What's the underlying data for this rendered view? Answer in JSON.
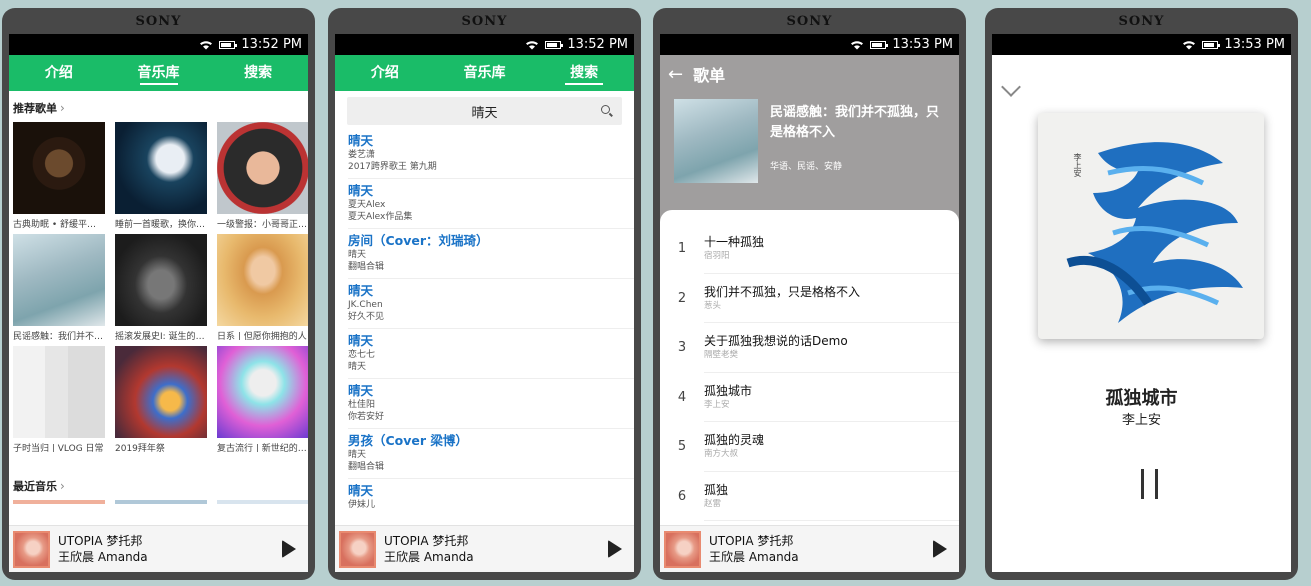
{
  "brand": "SONY",
  "status_times": [
    "13:52 PM",
    "13:52 PM",
    "13:53 PM",
    "13:53 PM"
  ],
  "tabs": [
    "介绍",
    "音乐库",
    "搜索"
  ],
  "library": {
    "recommend_title": "推荐歌单",
    "recent_title": "最近音乐",
    "playlists": [
      "古典助眠 • 舒缓平静的钢琴曲",
      "睡前一首暖歌，换你一夜好眠",
      "一级警报：小哥哥正在接近你",
      "民谣感触：我们并不孤独",
      "摇滚发展史I: 诞生的源头",
      "日系 | 但愿你拥抱的人",
      "子时当归 | VLOG 日常",
      "2019拜年祭",
      "复古流行 | 新世纪的浪潮"
    ]
  },
  "search": {
    "query": "晴天",
    "results": [
      {
        "title": "晴天",
        "a": "娄艺潇",
        "b": "2017跨界歌王 第九期"
      },
      {
        "title": "晴天",
        "a": "夏天Alex",
        "b": "夏天Alex作品集"
      },
      {
        "title": "房间（Cover：刘瑞琦）",
        "a": "晴天",
        "b": "翻唱合辑"
      },
      {
        "title": "晴天",
        "a": "JK.Chen",
        "b": "好久不见"
      },
      {
        "title": "晴天",
        "a": "恋七七",
        "b": "晴天"
      },
      {
        "title": "晴天",
        "a": "杜佳阳",
        "b": "你若安好"
      },
      {
        "title": "男孩（Cover 梁博）",
        "a": "晴天",
        "b": "翻唱合辑"
      },
      {
        "title": "晴天",
        "a": "伊妹儿",
        "b": ""
      }
    ]
  },
  "playlist_page": {
    "header": "歌单",
    "album_title": "民谣感触：我们并不孤独，只是格格不入",
    "tags": "华语、民谣、安静",
    "tracks": [
      {
        "num": "1",
        "name": "十一种孤独",
        "singer": "宿羽阳"
      },
      {
        "num": "2",
        "name": "我们并不孤独，只是格格不入",
        "singer": "葱头"
      },
      {
        "num": "3",
        "name": "关于孤独我想说的话Demo",
        "singer": "隔壁老樊"
      },
      {
        "num": "4",
        "name": "孤独城市",
        "singer": "李上安"
      },
      {
        "num": "5",
        "name": "孤独的灵魂",
        "singer": "南方大叔"
      },
      {
        "num": "6",
        "name": "孤独",
        "singer": "赵雷"
      }
    ]
  },
  "now_playing": {
    "title": "孤独城市",
    "artist": "李上安",
    "cover_text": "李上安"
  },
  "mini_player": {
    "title": "UTOPIA 梦托邦",
    "artist": "王欣晨 Amanda"
  },
  "colors": {
    "accent_green": "#1abc68",
    "link_blue": "#1a73c7"
  }
}
